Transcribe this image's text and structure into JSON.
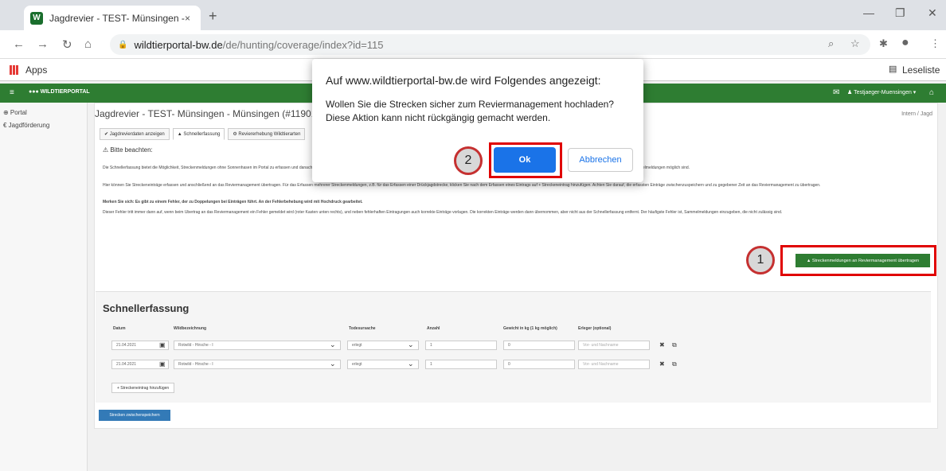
{
  "browser": {
    "tab_title": "Jagdrevier - TEST- Münsingen - | ",
    "tab_close": "×",
    "new_tab": "+",
    "win_min": "—",
    "win_restore": "❐",
    "win_close": "✕",
    "url_host": "wildtierportal-bw.de",
    "url_path": "/de/hunting/coverage/index?id=115",
    "bookmarks_apps": "Apps",
    "reading_list": "Leseliste"
  },
  "appbar": {
    "logo": "●●● WILDTIERPORTAL",
    "user": "♟ Testjaeger-Muensingen ▾"
  },
  "sidebar": {
    "items": [
      {
        "label": "⊕ Portal"
      },
      {
        "label": "€ Jagdförderung"
      }
    ]
  },
  "page": {
    "title": "Jagdrevier - TEST- Münsingen - Münsingen (#11901) - 999",
    "breadcrumb": "Intern / Jagd",
    "subtabs": [
      {
        "label": "✔ Jagdrevierdaten anzeigen"
      },
      {
        "label": "▲ Schnellerfassung"
      },
      {
        "label": "⚙ Reviererhebung Wildtierarten"
      }
    ],
    "note_title": "⚠ Bitte beachten:",
    "paragraphs": [
      "Die Schnellerfassung bietet die Möglichkeit, Streckenmeldungen ohne Sonnenhasen im Portal zu erfassen und danach gesammelt an das Reviermanagement zu übertragen. Bitte beachten Sie, dass bei den Tierarten, für die Sammelmeldungen nicht zulässig sind, auch in der Schnellerfassung keine Sammelmeldungen möglich sind.",
      "Hier können Sie Streckeneinträge erfassen und anschließend an das Reviermanagement übertragen. Für das Erfassen mehrerer Streckenmeldungen, z.B. für das Erfassen einer Drückjagdstrecke, klicken Sie nach dem Erfassen eines Eintrags auf + Streckeneintrag hinzufügen. Achten Sie darauf, die erfassten Einträge zwischenzuspeichern und zu gegebener Zeit an das Reviermanagement zu übertragen.",
      "Merken Sie sich: Es gibt zu einem Fehler, der zu Doppelungen bei Einträgen führt. An der Fehlerbehebung wird mit Hochdruck gearbeitet.",
      "Dieser Fehler tritt immer dann auf, wenn beim Übertrag an das Reviermanagement ein Fehler gemeldet wird (roter Kasten unten rechts), und neben fehlerhaften Eintragungen auch korrekte Einträge vorlagen. Die korrekten Einträge werden dann übernommen, aber nicht aus der Schnellerfassung entfernt. Der häufigste Fehler ist, Sammelmeldungen einzugeben, die nicht zulässig sind."
    ],
    "upload_button": "▲ Streckenmeldungen an Reviermanagement übertragen",
    "marker1": "1",
    "marker2": "2"
  },
  "schnellerfassung": {
    "title": "Schnellerfassung",
    "headers": [
      "Datum",
      "Wildbezeichnung",
      "Todesursache",
      "Anzahl",
      "Gewicht in kg (1 kg möglich)",
      "Erleger (optional)"
    ],
    "rows": [
      {
        "date": "21.04.2021",
        "wild": "Rotwild - Hirsche - I",
        "cause": "erlegt",
        "count": "1",
        "weight": "0",
        "hunter": "Vor- und Nachname"
      },
      {
        "date": "21.04.2021",
        "wild": "Rotwild - Hirsche - I",
        "cause": "erlegt",
        "count": "1",
        "weight": "0",
        "hunter": "Vor- und Nachname"
      }
    ],
    "add_row": "+ Streckeneintrag hinzufügen",
    "save_button": "Strecken zwischenspeichern"
  },
  "dialog": {
    "heading": "Auf www.wildtierportal-bw.de wird Folgendes angezeigt:",
    "message_line1": "Wollen Sie die Strecken sicher zum Reviermanagement hochladen?",
    "message_line2": "Diese Aktion kann nicht rückgängig gemacht werden.",
    "ok": "Ok",
    "cancel": "Abbrechen"
  }
}
